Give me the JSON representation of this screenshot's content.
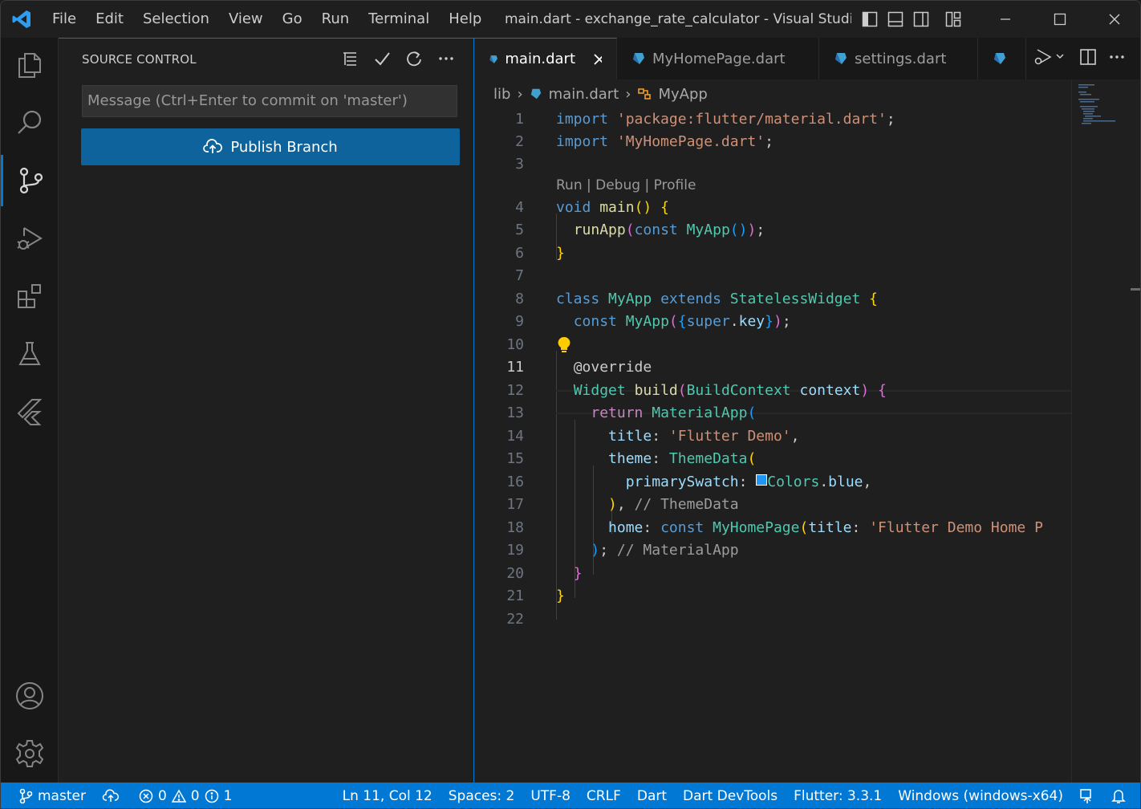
{
  "window": {
    "title": "main.dart - exchange_rate_calculator - Visual Studio ...",
    "menu": [
      "File",
      "Edit",
      "Selection",
      "View",
      "Go",
      "Run",
      "Terminal",
      "Help"
    ]
  },
  "activity_bar": {
    "items": [
      "explorer-icon",
      "search-icon",
      "source-control-icon",
      "run-debug-icon",
      "extensions-icon",
      "testing-icon",
      "flutter-icon"
    ],
    "bottom": [
      "accounts-icon",
      "manage-gear-icon"
    ],
    "active": "source-control-icon"
  },
  "sidebar": {
    "title": "SOURCE CONTROL",
    "message_placeholder": "Message (Ctrl+Enter to commit on 'master')",
    "publish_label": "Publish Branch"
  },
  "editor": {
    "tabs": [
      {
        "label": "main.dart",
        "active": true
      },
      {
        "label": "MyHomePage.dart",
        "active": false
      },
      {
        "label": "settings.dart",
        "active": false
      }
    ],
    "breadcrumb": [
      "lib",
      "main.dart",
      "MyApp"
    ],
    "codelens": "Run | Debug | Profile",
    "line_numbers": [
      "1",
      "2",
      "3",
      "4",
      "5",
      "6",
      "7",
      "8",
      "9",
      "10",
      "11",
      "12",
      "13",
      "14",
      "15",
      "16",
      "17",
      "18",
      "19",
      "20",
      "21",
      "22"
    ],
    "current_line": "11",
    "code": [
      "import 'package:flutter/material.dart';",
      "import 'MyHomePage.dart';",
      "",
      "void main() {",
      "  runApp(const MyApp());",
      "}",
      "",
      "class MyApp extends StatelessWidget {",
      "  const MyApp({super.key});",
      "",
      "  @override",
      "  Widget build(BuildContext context) {",
      "    return MaterialApp(",
      "      title: 'Flutter Demo',",
      "      theme: ThemeData(",
      "        primarySwatch: Colors.blue,",
      "      ), // ThemeData",
      "      home: const MyHomePage(title: 'Flutter Demo Home P",
      "    ); // MaterialApp",
      "  }",
      "}",
      ""
    ]
  },
  "status_bar": {
    "branch": "master",
    "errors": "0",
    "warnings": "0",
    "info": "1",
    "position": "Ln 11, Col 12",
    "spaces": "Spaces: 2",
    "encoding": "UTF-8",
    "eol": "CRLF",
    "language": "Dart",
    "devtools": "Dart DevTools",
    "flutter": "Flutter: 3.3.1",
    "device": "Windows (windows-x64)"
  },
  "colors": {
    "accent": "#0078d4",
    "publish_button": "#0e639c",
    "swatch_blue": "#2196f3"
  }
}
